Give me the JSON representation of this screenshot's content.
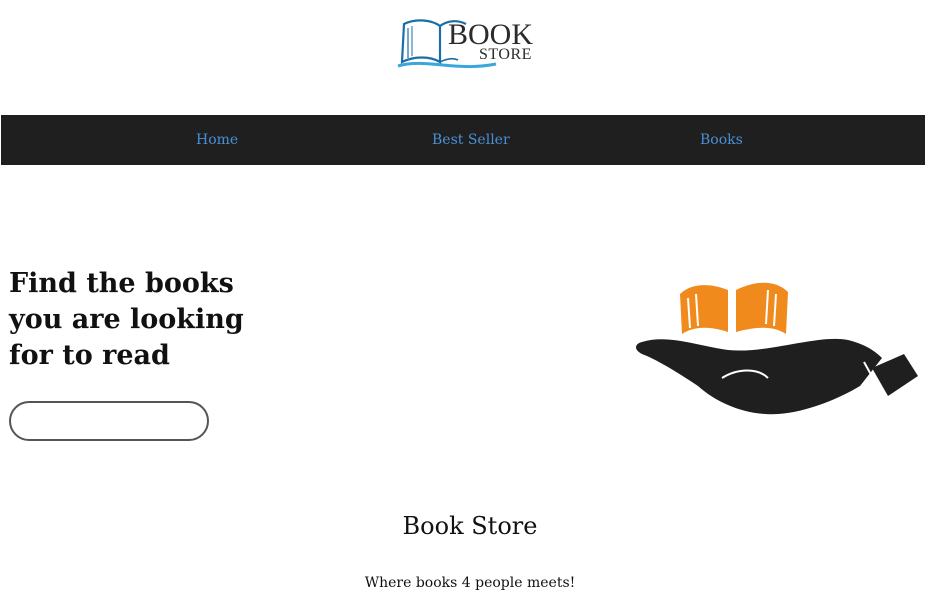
{
  "logo": {
    "word_top": "BOOK",
    "word_bottom": "STORE",
    "icon": "open-book-icon"
  },
  "nav": {
    "items": [
      {
        "label": "Home"
      },
      {
        "label": "Best Seller"
      },
      {
        "label": "Books"
      }
    ],
    "link_color": "#4a8fd6",
    "background": "#1f1f1f"
  },
  "hero": {
    "title": "Find the books you are looking for to read",
    "search": {
      "value": "",
      "placeholder": ""
    },
    "illustration_icon": "hand-holding-book-icon",
    "accent_color": "#f08a1c"
  },
  "footer": {
    "site_title": "Book Store",
    "tagline": "Where books 4 people meets!"
  }
}
